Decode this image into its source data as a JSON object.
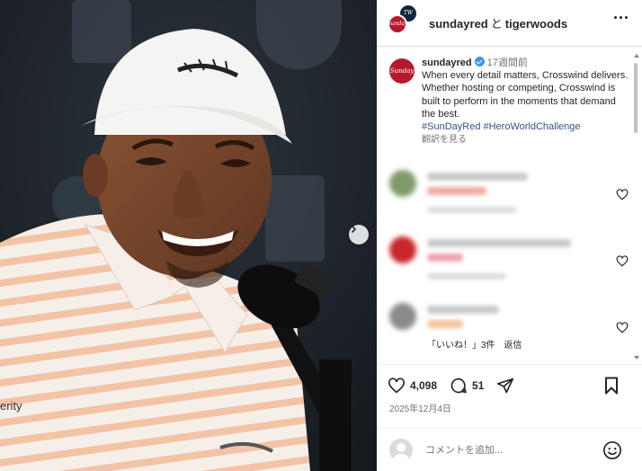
{
  "header": {
    "user_a": "sundayred",
    "joiner": "と",
    "user_b": "tigerwoods",
    "avatar_a_mark": "Sunday",
    "avatar_b_mark": "TW"
  },
  "caption": {
    "username": "sundayred",
    "time_ago": "17週間前",
    "text": "When every detail matters, Crosswind delivers. Whether hosting or competing, Crosswind is built to perform in the moments that demand the best.",
    "hashtags": [
      "#SunDayRed",
      "#HeroWorldChallenge"
    ],
    "translate": "翻訳を見る"
  },
  "comments_footer": {
    "likes": "「いいね！」3件",
    "reply": "返信"
  },
  "actions": {
    "like_count": "4,098",
    "comment_count": "51",
    "date": "2025年12月4日"
  },
  "comment_box": {
    "placeholder": "コメントを追加..."
  },
  "photo": {
    "shirt_text": "erity"
  },
  "colors": {
    "brand_red": "#b7182d",
    "verified_blue": "#3897f0",
    "hashtag_blue": "#385185"
  }
}
